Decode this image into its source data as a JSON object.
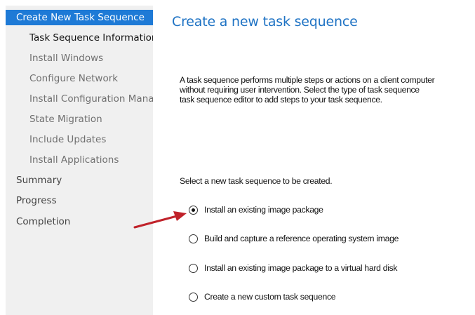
{
  "sidebar": {
    "items": [
      {
        "label": "Create New Task Sequence"
      },
      {
        "label": "Task Sequence Information"
      },
      {
        "label": "Install Windows"
      },
      {
        "label": "Configure Network"
      },
      {
        "label": "Install Configuration Manager"
      },
      {
        "label": "State Migration"
      },
      {
        "label": "Include Updates"
      },
      {
        "label": "Install Applications"
      },
      {
        "label": "Summary"
      },
      {
        "label": "Progress"
      },
      {
        "label": "Completion"
      }
    ]
  },
  "main": {
    "title": "Create a new task sequence",
    "description_lines": [
      "A task sequence performs multiple steps or actions on a client computer",
      "without requiring user intervention. Select the type of task sequence",
      "task sequence editor to add steps to your task sequence."
    ],
    "select_label": "Select a new task sequence to be created.",
    "options": [
      {
        "label": "Install an existing image package",
        "selected": true
      },
      {
        "label": "Build and capture a reference operating system image",
        "selected": false
      },
      {
        "label": "Install an existing image package to a virtual hard disk",
        "selected": false
      },
      {
        "label": "Create a new custom task sequence",
        "selected": false
      }
    ]
  },
  "colors": {
    "sidebar_bg": "#f0f0f0",
    "active_highlight": "#1e7ad6",
    "title_blue": "#1f73c4",
    "annotation_arrow": "#c0222a"
  },
  "icons": {
    "annotation": "red-arrow-icon"
  }
}
